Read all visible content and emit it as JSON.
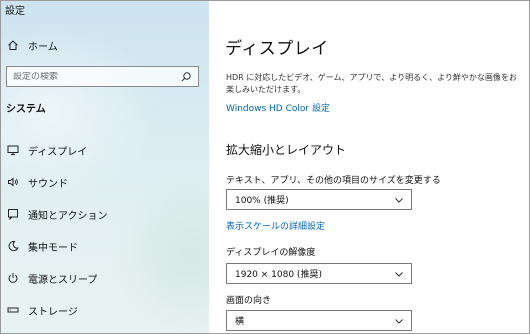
{
  "window": {
    "title": "設定"
  },
  "sidebar": {
    "home_label": "ホーム",
    "search_placeholder": "設定の検索",
    "section_title": "システム",
    "items": [
      {
        "label": "ディスプレイ",
        "icon": "monitor-icon"
      },
      {
        "label": "サウンド",
        "icon": "speaker-icon"
      },
      {
        "label": "通知とアクション",
        "icon": "notification-icon"
      },
      {
        "label": "集中モード",
        "icon": "moon-icon"
      },
      {
        "label": "電源とスリープ",
        "icon": "power-icon"
      },
      {
        "label": "ストレージ",
        "icon": "storage-icon"
      }
    ]
  },
  "main": {
    "title": "ディスプレイ",
    "hdr_description": "HDR に対応したビデオ、ゲーム、アプリで、より明るく、より鮮やかな画像をお楽しみいただけます。",
    "hdr_link": "Windows HD Color 設定",
    "scale_section_title": "拡大縮小とレイアウト",
    "scale_label": "テキスト、アプリ、その他の項目のサイズを変更する",
    "scale_value": "100% (推奨)",
    "advanced_scale_link": "表示スケールの詳細設定",
    "resolution_label": "ディスプレイの解像度",
    "resolution_value": "1920 × 1080 (推奨)",
    "orientation_label": "画面の向き",
    "orientation_value": "横"
  },
  "colors": {
    "link": "#0067b8",
    "sidebar_bg": "#d6e9f1",
    "text": "#111111"
  }
}
